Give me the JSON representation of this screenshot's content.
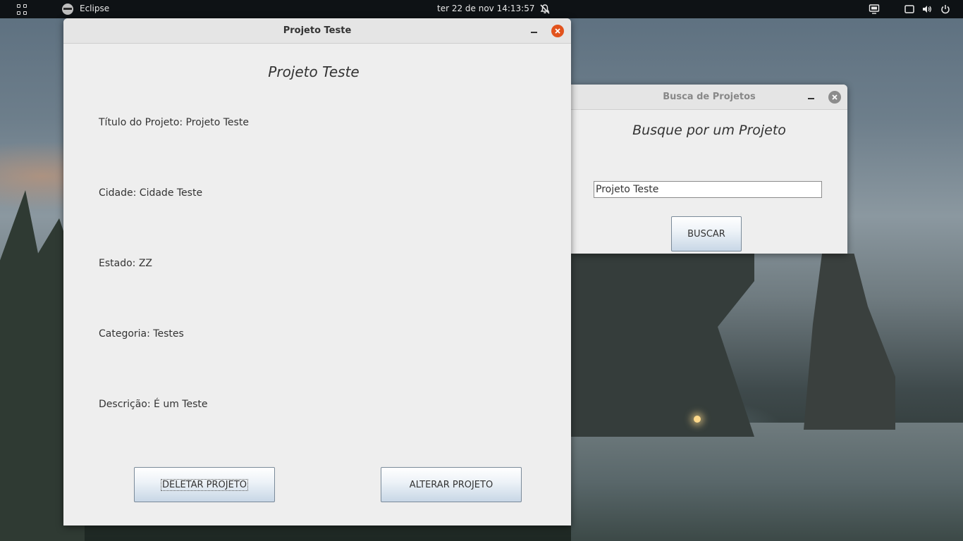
{
  "topbar": {
    "app_name": "Eclipse",
    "clock": "ter 22 de nov  14:13:57"
  },
  "main_window": {
    "title": "Projeto Teste",
    "heading": "Projeto Teste",
    "fields": {
      "titulo": "Título do Projeto: Projeto Teste",
      "cidade": "Cidade: Cidade Teste",
      "estado": "Estado: ZZ",
      "categoria": "Categoria: Testes",
      "descricao": "Descrição: É um Teste"
    },
    "buttons": {
      "delete": "DELETAR PROJETO",
      "alter": "ALTERAR PROJETO"
    }
  },
  "search_window": {
    "title": "Busca de Projetos",
    "heading": "Busque por um Projeto",
    "input_value": "Projeto Teste",
    "button": "BUSCAR"
  },
  "colors": {
    "close_active": "#e2531d",
    "close_inactive": "#8c8c8c",
    "window_bg": "#eeeeee"
  }
}
